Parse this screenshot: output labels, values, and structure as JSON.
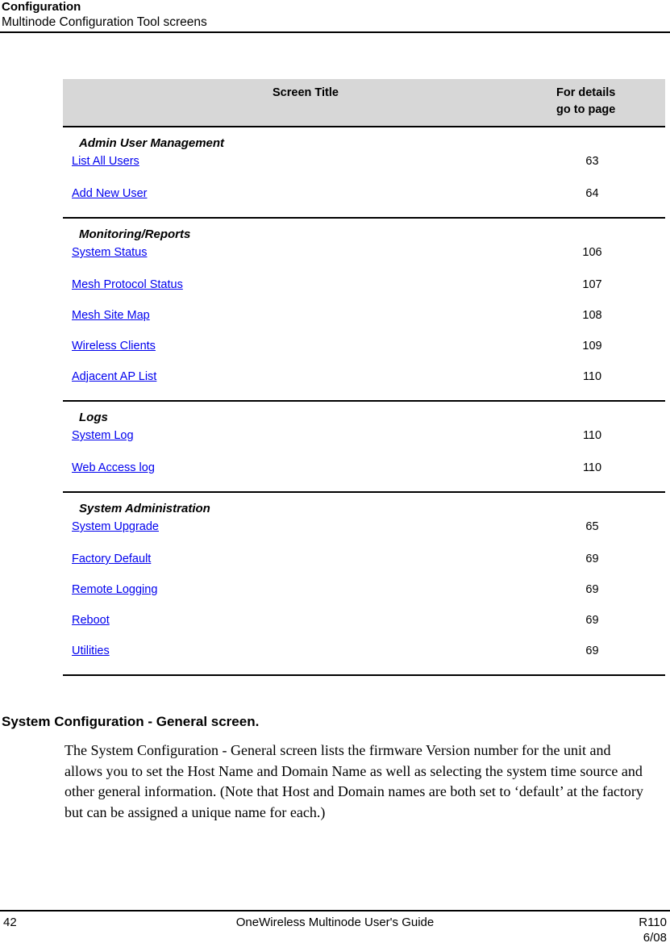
{
  "header": {
    "line1": "Configuration",
    "line2": "Multinode Configuration Tool screens"
  },
  "table": {
    "columns": {
      "screen_title": "Screen Title",
      "for_details_line1": "For details",
      "for_details_line2": "go to page"
    },
    "sections": [
      {
        "title": "Admin User Management",
        "rows": [
          {
            "label": "List All Users",
            "page": "63"
          },
          {
            "label": "Add New User",
            "page": "64"
          }
        ]
      },
      {
        "title": "Monitoring/Reports",
        "rows": [
          {
            "label": "System Status",
            "page": "106"
          },
          {
            "label": "Mesh Protocol Status",
            "page": "107"
          },
          {
            "label": "Mesh Site Map",
            "page": "108"
          },
          {
            "label": "Wireless Clients",
            "page": "109"
          },
          {
            "label": "Adjacent AP List",
            "page": "110"
          }
        ]
      },
      {
        "title": "Logs",
        "rows": [
          {
            "label": "System Log",
            "page": "110"
          },
          {
            "label": "Web Access log",
            "page": "110"
          }
        ]
      },
      {
        "title": "System Administration",
        "rows": [
          {
            "label": "System Upgrade",
            "page": "65"
          },
          {
            "label": "Factory Default",
            "page": "69"
          },
          {
            "label": "Remote Logging",
            "page": "69"
          },
          {
            "label": "Reboot",
            "page": "69"
          },
          {
            "label": "Utilities",
            "page": "69"
          }
        ]
      }
    ]
  },
  "body": {
    "heading": "System Configuration - General screen.",
    "paragraph": "The System Configuration - General screen lists the firmware Version number for the unit and allows you to set the Host Name and Domain Name as well as selecting the system time source and other general information. (Note that Host and Domain names are both set to ‘default’ at the factory but can be assigned a unique name for each.)"
  },
  "footer": {
    "page_number": "42",
    "document_title": "OneWireless Multinode User's Guide",
    "revision": "R110",
    "date": "6/08"
  },
  "colors": {
    "link": "#0000ee",
    "table_header_background": "#d7d7d7",
    "rule": "#000000"
  }
}
